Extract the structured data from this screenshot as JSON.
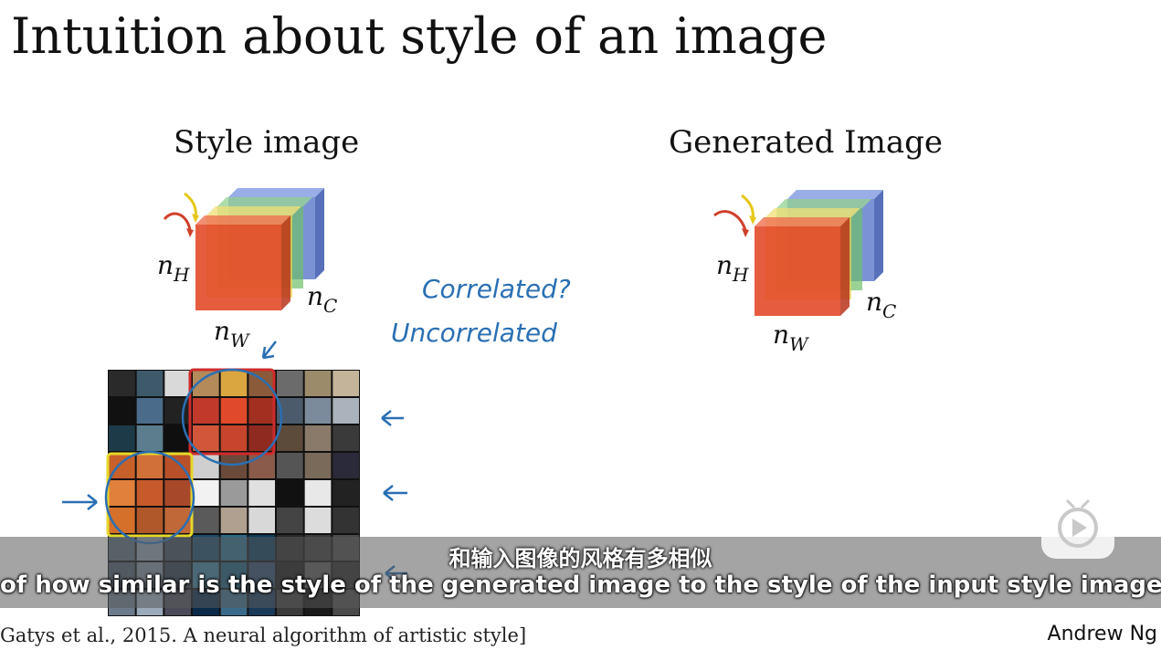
{
  "slide": {
    "title": "Intuition about style of an image",
    "style_heading": "Style image",
    "generated_heading": "Generated Image",
    "citation": "Gatys et al., 2015. A neural algorithm of artistic style]",
    "author": "Andrew Ng"
  },
  "volume_labels": {
    "height": "n",
    "height_sub": "H",
    "width": "n",
    "width_sub": "W",
    "channels": "n",
    "channels_sub": "C"
  },
  "annotations": {
    "correlated": "Correlated?",
    "uncorrelated": "Uncorrelated"
  },
  "subtitles": {
    "chinese": "和输入图像的风格有多相似",
    "english": "of how similar is the style of the generated image to the style of the input style image."
  },
  "player": {
    "play_icon": "play-icon"
  },
  "colors": {
    "red_channel": "#e34a2a",
    "yellow_channel": "#e8d24a",
    "green_channel": "#6fbf6a",
    "blue_channel": "#4f6fc7",
    "annotation_ink": "#2a6fb3",
    "highlight_red": "#d02b2b",
    "highlight_yellow": "#e6d82a"
  }
}
